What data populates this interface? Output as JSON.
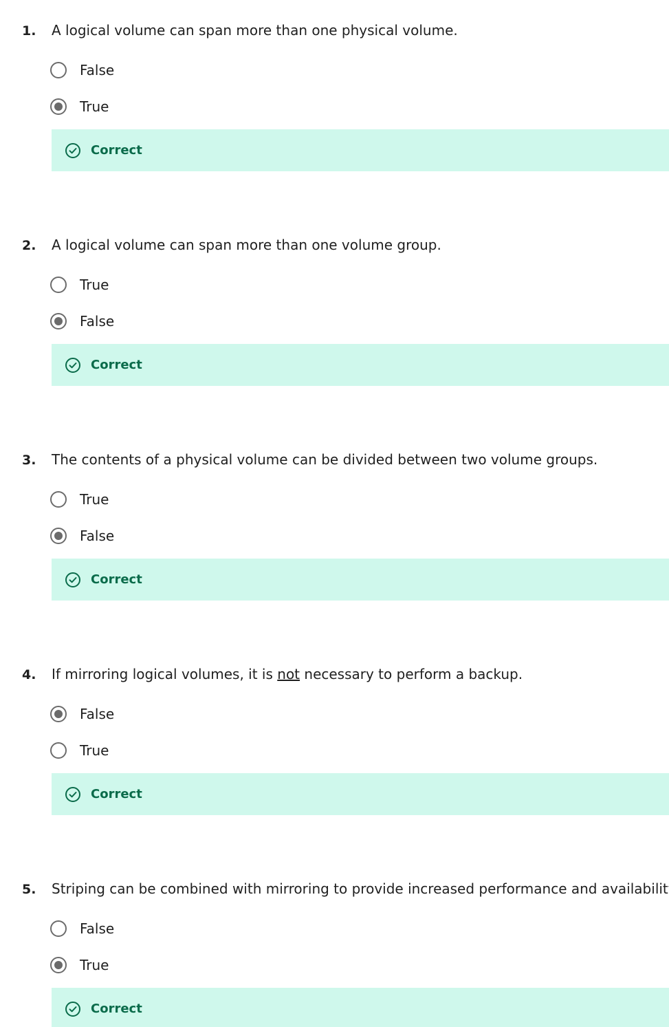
{
  "colors": {
    "feedback_bg": "#cff8ec",
    "feedback_text": "#0a6b4a",
    "radio_border": "#6b6b6b"
  },
  "questions": [
    {
      "number": "1.",
      "text": "A logical volume can span more than one physical volume.",
      "options": [
        {
          "label": "False",
          "selected": false
        },
        {
          "label": "True",
          "selected": true
        }
      ],
      "feedback": {
        "icon": "check-circle-icon",
        "label": "Correct"
      }
    },
    {
      "number": "2.",
      "text": "A logical volume can span more than one volume group.",
      "options": [
        {
          "label": "True",
          "selected": false
        },
        {
          "label": "False",
          "selected": true
        }
      ],
      "feedback": {
        "icon": "check-circle-icon",
        "label": "Correct"
      }
    },
    {
      "number": "3.",
      "text": "The contents of a physical volume can be divided between two volume groups.",
      "options": [
        {
          "label": "True",
          "selected": false
        },
        {
          "label": "False",
          "selected": true
        }
      ],
      "feedback": {
        "icon": "check-circle-icon",
        "label": "Correct"
      }
    },
    {
      "number": "4.",
      "text_before": "If mirroring logical volumes, it is ",
      "text_underlined": "not",
      "text_after": " necessary to perform a backup.",
      "options": [
        {
          "label": "False",
          "selected": true
        },
        {
          "label": "True",
          "selected": false
        }
      ],
      "feedback": {
        "icon": "check-circle-icon",
        "label": "Correct"
      }
    },
    {
      "number": "5.",
      "text": "Striping can be combined with mirroring to provide increased performance and availability.",
      "options": [
        {
          "label": "False",
          "selected": false
        },
        {
          "label": "True",
          "selected": true
        }
      ],
      "feedback": {
        "icon": "check-circle-icon",
        "label": "Correct"
      }
    }
  ]
}
